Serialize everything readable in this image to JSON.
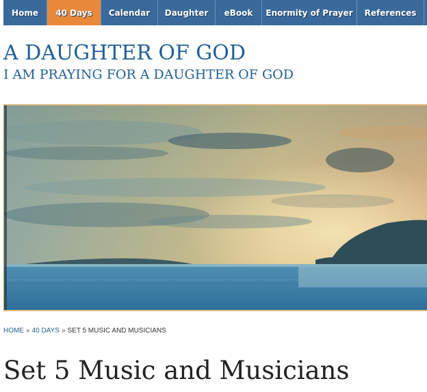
{
  "nav": {
    "items": [
      {
        "label": "Home",
        "active": false
      },
      {
        "label": "40 Days",
        "active": true
      },
      {
        "label": "Calendar",
        "active": false
      },
      {
        "label": "Daughter",
        "active": false
      },
      {
        "label": "eBook",
        "active": false
      },
      {
        "label": "Enormity of Prayer",
        "active": false
      },
      {
        "label": "References",
        "active": false
      }
    ]
  },
  "header": {
    "title": "A DAUGHTER OF GOD",
    "description": "I AM PRAYING FOR A DAUGHTER OF GOD"
  },
  "breadcrumb": {
    "home": "HOME",
    "separator": "»",
    "section": "40 DAYS",
    "current": "SET 5 MUSIC AND MUSICIANS"
  },
  "page": {
    "title": "Set 5 Music and Musicians"
  },
  "colors": {
    "nav_bg": "#3a6a9b",
    "nav_active": "#e8883a",
    "title_blue": "#1f5f9a"
  }
}
